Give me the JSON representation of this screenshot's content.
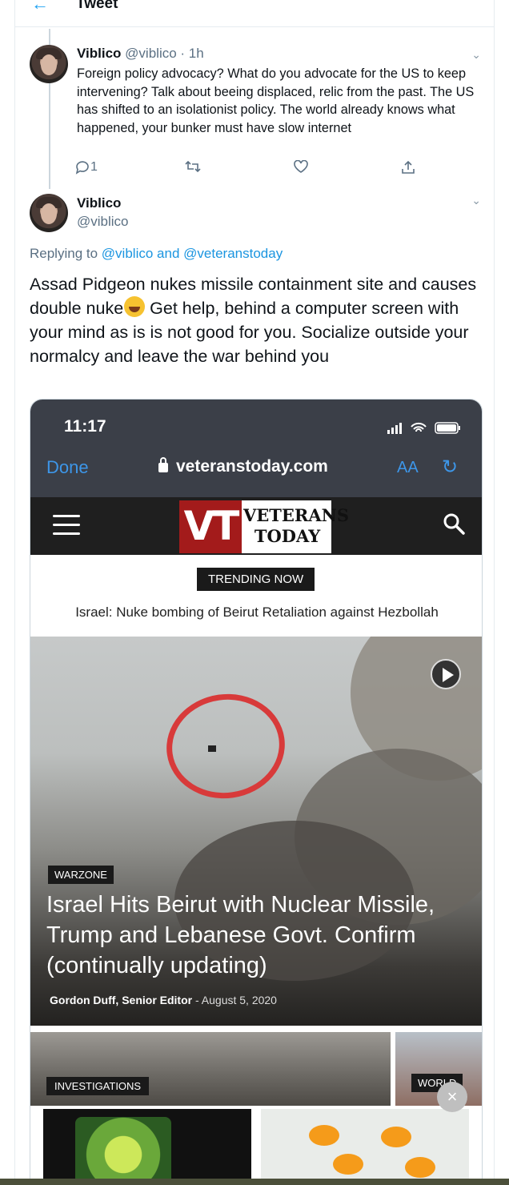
{
  "header": {
    "title": "Tweet",
    "back_icon": "arrow-left-icon"
  },
  "tweet1": {
    "name": "Viblico",
    "handle": "@viblico",
    "time": "· 1h",
    "text": "Foreign policy advocacy? What do you advocate for the US to keep intervening? Talk about beeing displaced, relic from the past. The US has shifted to an isolationist policy. The world already knows what happened, your bunker must have slow internet",
    "reply_count": "1"
  },
  "tweet2": {
    "name": "Viblico",
    "handle": "@viblico",
    "replying_prefix": "Replying to",
    "replying_mention1": "@viblico",
    "replying_and": "and",
    "replying_mention2": "@veteranstoday",
    "text_part1": "Assad Pidgeon nukes missile containment site and causes double nuke",
    "text_part2": " Get help, behind a computer screen with your mind as is is not good for you. Socialize outside your normalcy and leave the war behind you"
  },
  "embedded": {
    "clock": "11:17",
    "done": "Done",
    "url": "veteranstoday.com",
    "text_size": "AA",
    "logo_mark": "VT",
    "logo_line1": "VETERANS",
    "logo_line2": "TODAY",
    "trending_badge": "TRENDING NOW",
    "trending_text": "Israel: Nuke bombing of Beirut Retaliation against Hezbollah",
    "hero_category": "WARZONE",
    "hero_headline": "Israel Hits Beirut with Nuclear Missile, Trump and Lebanese Govt. Confirm (continually updating)",
    "hero_author": "Gordon Duff, Senior Editor",
    "hero_date": "-  August 5, 2020",
    "category2": "INVESTIGATIONS",
    "category3": "WORLD",
    "close": "×"
  },
  "colors": {
    "link": "#1b95e0",
    "accent": "#1da1f2",
    "logo_red": "#a31b1b"
  }
}
